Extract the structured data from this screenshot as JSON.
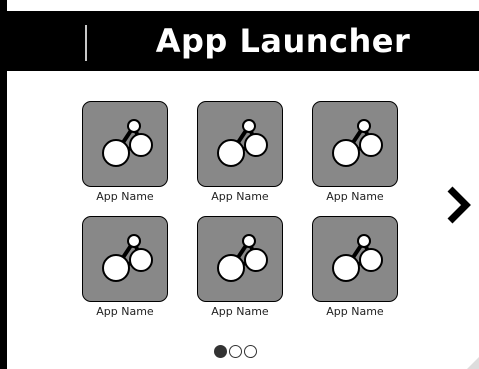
{
  "header": {
    "title": "App Launcher"
  },
  "apps": [
    {
      "label": "App Name",
      "icon": "molecule-icon"
    },
    {
      "label": "App Name",
      "icon": "molecule-icon"
    },
    {
      "label": "App Name",
      "icon": "molecule-icon"
    },
    {
      "label": "App Name",
      "icon": "molecule-icon"
    },
    {
      "label": "App Name",
      "icon": "molecule-icon"
    },
    {
      "label": "App Name",
      "icon": "molecule-icon"
    }
  ],
  "navigation": {
    "next_icon": "chevron-right-icon"
  },
  "pagination": {
    "pages": 3,
    "active_page": 1
  },
  "colors": {
    "header_bg": "#000000",
    "tile_bg": "#888888",
    "page_bg": "#ffffff"
  }
}
